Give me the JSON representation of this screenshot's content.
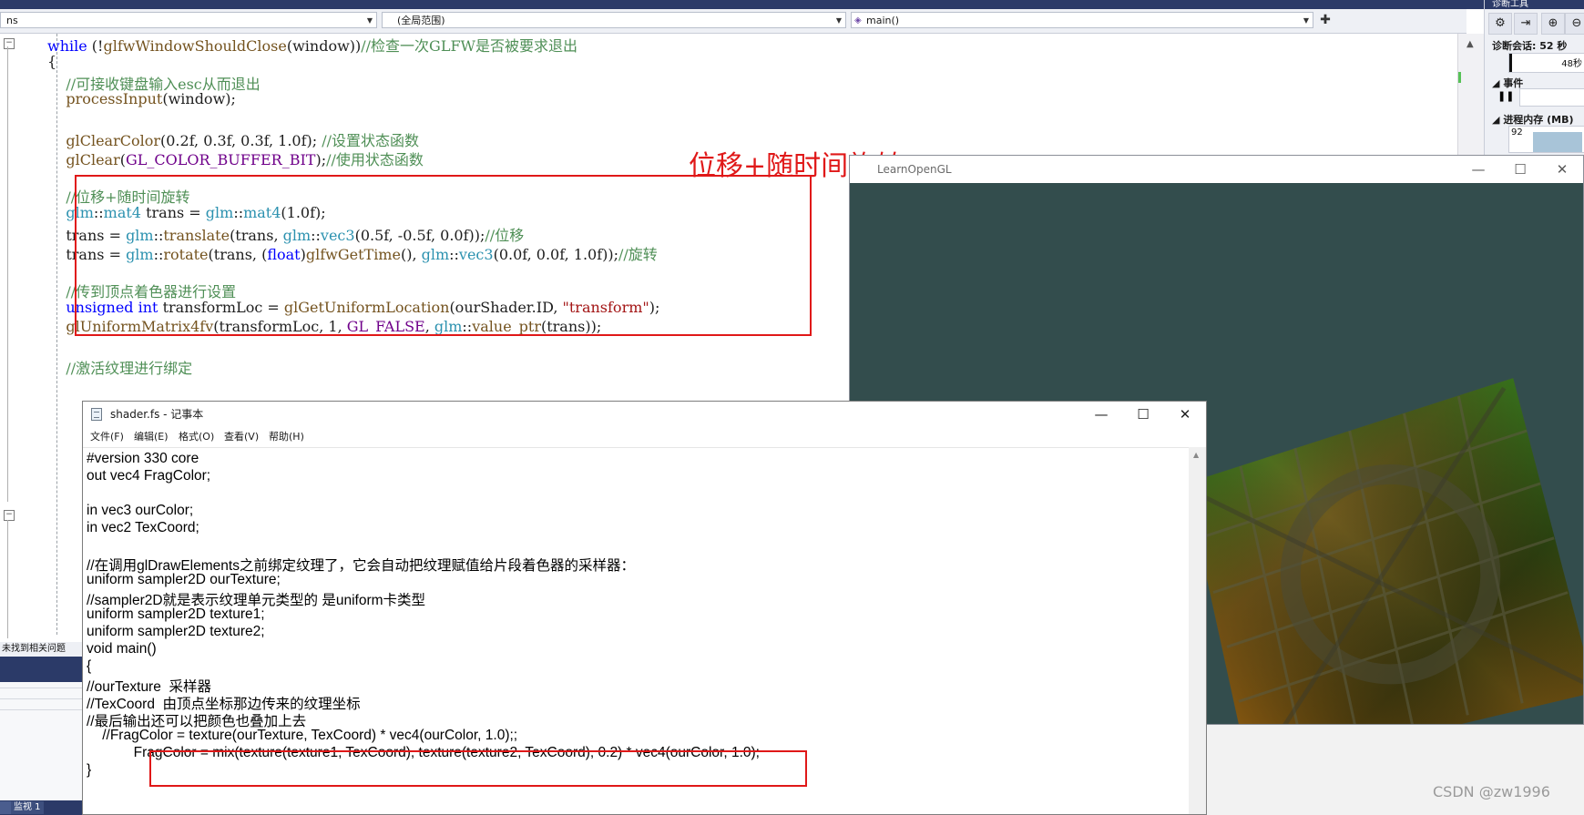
{
  "vs": {
    "nav": {
      "left_dropdown": "ns",
      "scope_dropdown": "(全局范围)",
      "member_dropdown": "main()"
    },
    "code_lines": [
      [
        {
          "t": "while",
          "c": "k"
        },
        {
          "t": " (!",
          "c": "n"
        },
        {
          "t": "glfwWindowShouldClose",
          "c": "f"
        },
        {
          "t": "(window))",
          "c": "n"
        },
        {
          "t": "//检查一次GLFW是否被要求退出",
          "c": "c"
        }
      ],
      [
        {
          "t": "{",
          "c": "n"
        }
      ],
      [
        {
          "t": "    //可接收键盘输入esc从而退出",
          "c": "c"
        }
      ],
      [
        {
          "t": "    ",
          "c": "n"
        },
        {
          "t": "processInput",
          "c": "f"
        },
        {
          "t": "(window);",
          "c": "n"
        }
      ],
      [],
      [
        {
          "t": "    ",
          "c": "n"
        },
        {
          "t": "glClearColor",
          "c": "f"
        },
        {
          "t": "(0.2f, 0.3f, 0.3f, 1.0f); ",
          "c": "n"
        },
        {
          "t": "//设置状态函数",
          "c": "c"
        }
      ],
      [
        {
          "t": "    ",
          "c": "n"
        },
        {
          "t": "glClear",
          "c": "f"
        },
        {
          "t": "(",
          "c": "n"
        },
        {
          "t": "GL_COLOR_BUFFER_BIT",
          "c": "m"
        },
        {
          "t": ");",
          "c": "n"
        },
        {
          "t": "//使用状态函数",
          "c": "c"
        }
      ],
      [],
      [
        {
          "t": "    //位移+随时间旋转",
          "c": "c"
        }
      ],
      [
        {
          "t": "    ",
          "c": "n"
        },
        {
          "t": "glm",
          "c": "t"
        },
        {
          "t": "::",
          "c": "n"
        },
        {
          "t": "mat4",
          "c": "t"
        },
        {
          "t": " trans = ",
          "c": "n"
        },
        {
          "t": "glm",
          "c": "t"
        },
        {
          "t": "::",
          "c": "n"
        },
        {
          "t": "mat4",
          "c": "t"
        },
        {
          "t": "(1.0f);",
          "c": "n"
        }
      ],
      [
        {
          "t": "    trans = ",
          "c": "n"
        },
        {
          "t": "glm",
          "c": "t"
        },
        {
          "t": "::",
          "c": "n"
        },
        {
          "t": "translate",
          "c": "f"
        },
        {
          "t": "(trans, ",
          "c": "n"
        },
        {
          "t": "glm",
          "c": "t"
        },
        {
          "t": "::",
          "c": "n"
        },
        {
          "t": "vec3",
          "c": "t"
        },
        {
          "t": "(0.5f, -0.5f, 0.0f));",
          "c": "n"
        },
        {
          "t": "//位移",
          "c": "c"
        }
      ],
      [
        {
          "t": "    trans = ",
          "c": "n"
        },
        {
          "t": "glm",
          "c": "t"
        },
        {
          "t": "::",
          "c": "n"
        },
        {
          "t": "rotate",
          "c": "f"
        },
        {
          "t": "(trans, (",
          "c": "n"
        },
        {
          "t": "float",
          "c": "k"
        },
        {
          "t": ")",
          "c": "n"
        },
        {
          "t": "glfwGetTime",
          "c": "f"
        },
        {
          "t": "(), ",
          "c": "n"
        },
        {
          "t": "glm",
          "c": "t"
        },
        {
          "t": "::",
          "c": "n"
        },
        {
          "t": "vec3",
          "c": "t"
        },
        {
          "t": "(0.0f, 0.0f, 1.0f));",
          "c": "n"
        },
        {
          "t": "//旋转",
          "c": "c"
        }
      ],
      [],
      [
        {
          "t": "    //传到顶点着色器进行设置",
          "c": "c"
        }
      ],
      [
        {
          "t": "    ",
          "c": "n"
        },
        {
          "t": "unsigned int",
          "c": "k"
        },
        {
          "t": " transformLoc = ",
          "c": "n"
        },
        {
          "t": "glGetUniformLocation",
          "c": "f"
        },
        {
          "t": "(ourShader.ID, ",
          "c": "n"
        },
        {
          "t": "\"transform\"",
          "c": "s"
        },
        {
          "t": ");",
          "c": "n"
        }
      ],
      [
        {
          "t": "    ",
          "c": "n"
        },
        {
          "t": "glUniformMatrix4fv",
          "c": "f"
        },
        {
          "t": "(transformLoc, 1, ",
          "c": "n"
        },
        {
          "t": "GL_FALSE",
          "c": "m"
        },
        {
          "t": ", ",
          "c": "n"
        },
        {
          "t": "glm",
          "c": "t"
        },
        {
          "t": "::",
          "c": "n"
        },
        {
          "t": "value_ptr",
          "c": "f"
        },
        {
          "t": "(trans));",
          "c": "n"
        }
      ],
      [],
      [
        {
          "t": "    //激活纹理进行绑定",
          "c": "c"
        }
      ]
    ],
    "error_list_text": "未找到相关问题",
    "bottom_tabs": [
      "监视 1"
    ]
  },
  "annotation": "位移+随时间旋转",
  "diagnostics": {
    "title": "诊断工具",
    "session_label": "诊断会话: 52 秒",
    "time_label": "48秒",
    "events_label": "事件",
    "memory_label": "进程内存 (MB)",
    "memory_value": "92"
  },
  "gl_window": {
    "title": "LearnOpenGL",
    "bg_color": "#334d4d"
  },
  "notepad": {
    "title": "shader.fs - 记事本",
    "menu": [
      "文件(F)",
      "编辑(E)",
      "格式(O)",
      "查看(V)",
      "帮助(H)"
    ],
    "lines": [
      "#version 330 core",
      "out vec4 FragColor;",
      "",
      "in vec3 ourColor;",
      "in vec2 TexCoord;",
      "",
      "//在调用glDrawElements之前绑定纹理了，它会自动把纹理赋值给片段着色器的采样器：",
      "uniform sampler2D ourTexture;",
      "//sampler2D就是表示纹理单元类型的 是uniform卡类型",
      "uniform sampler2D texture1;",
      "uniform sampler2D texture2;",
      "void main()",
      "{",
      "//ourTexture  采样器",
      "//TexCoord  由顶点坐标那边传来的纹理坐标",
      "//最后输出还可以把颜色也叠加上去",
      "    //FragColor = texture(ourTexture, TexCoord) * vec4(ourColor, 1.0);;",
      "            FragColor = mix(texture(texture1, TexCoord), texture(texture2, TexCoord), 0.2) * vec4(ourColor, 1.0);",
      "}"
    ]
  },
  "watermark": "CSDN @zw1996",
  "colors": {
    "highlight": "#e01818",
    "vs_accent": "#2b3a68"
  }
}
